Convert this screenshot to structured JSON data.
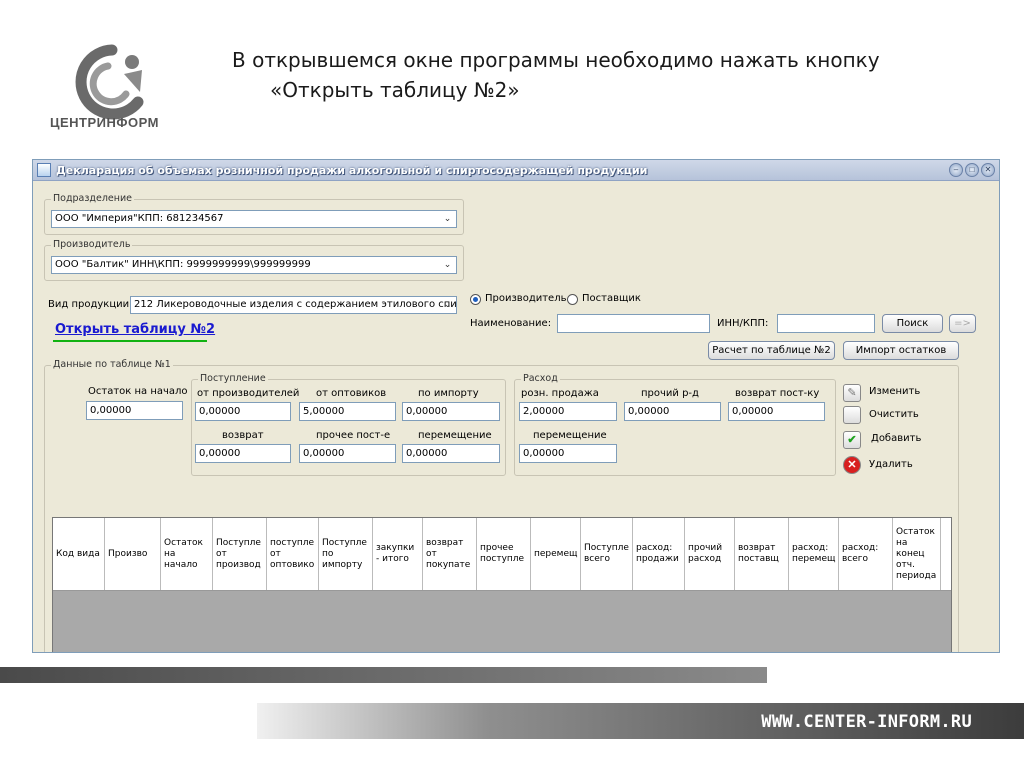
{
  "brand": {
    "name": "ЦЕНТРИНФОРМ",
    "site": "WWW.CENTER-INFORM.RU"
  },
  "slide": {
    "line1": "В открывшемся окне программы необходимо нажать кнопку",
    "line2": "«Открыть таблицу №2»"
  },
  "window": {
    "title": "Декларация об объемах розничной продажи алкогольной и спиртосодержащей продукции",
    "subdivision": {
      "label": "Подразделение",
      "value": "ООО \"Империя\"КПП: 681234567"
    },
    "producer": {
      "label": "Производитель",
      "value": "ООО \"Балтик\"   ИНН\\КПП: 9999999999\\999999999"
    },
    "product": {
      "label": "Вид продукции:",
      "value": "212 Ликероводочные изделия с содержанием этилового спир"
    },
    "open_link": "Открыть таблицу №2",
    "radio_producer": "Производитель",
    "radio_supplier": "Поставщик",
    "name_label": "Наименование:",
    "inn_label": "ИНН/КПП:",
    "search_btn": "Поиск",
    "arrow_btn": "=>",
    "calc_btn": "Расчет по таблице №2",
    "import_btn": "Импорт остатков",
    "data_group": "Данные по таблице №1",
    "start_label": "Остаток на начало",
    "start_val": "0,00000",
    "income": {
      "title": "Поступление",
      "from_prod": "от производителей",
      "from_prod_val": "0,00000",
      "from_wholesale": "от оптовиков",
      "from_wholesale_val": "5,00000",
      "import": "по импорту",
      "import_val": "0,00000",
      "return": "возврат",
      "return_val": "0,00000",
      "other": "прочее пост-е",
      "other_val": "0,00000",
      "move": "перемещение",
      "move_val": "0,00000"
    },
    "expense": {
      "title": "Расход",
      "retail": "розн. продажа",
      "retail_val": "2,00000",
      "other": "прочий р-д",
      "other_val": "0,00000",
      "return": "возврат пост-ку",
      "return_val": "0,00000",
      "move": "перемещение",
      "move_val": "0,00000"
    },
    "actions": {
      "edit": "Изменить",
      "clear": "Очистить",
      "add": "Добавить",
      "delete": "Удалить"
    },
    "columns": [
      "Код вида",
      "Произво",
      "Остаток на начало",
      "Поступле от производ",
      "поступле от оптовико",
      "Поступле по импорту",
      "закупки - итого",
      "возврат от покупате",
      "прочее поступле",
      "перемещ",
      "Поступле всего",
      "расход: продажи",
      "прочий расход",
      "возврат поставщ",
      "расход: перемещ",
      "расход: всего",
      "Остаток на конец отч. периода"
    ]
  },
  "colors": {
    "accent_link": "#1a1ad0",
    "highlight": "#12b212",
    "window_bg": "#ece9d8"
  }
}
